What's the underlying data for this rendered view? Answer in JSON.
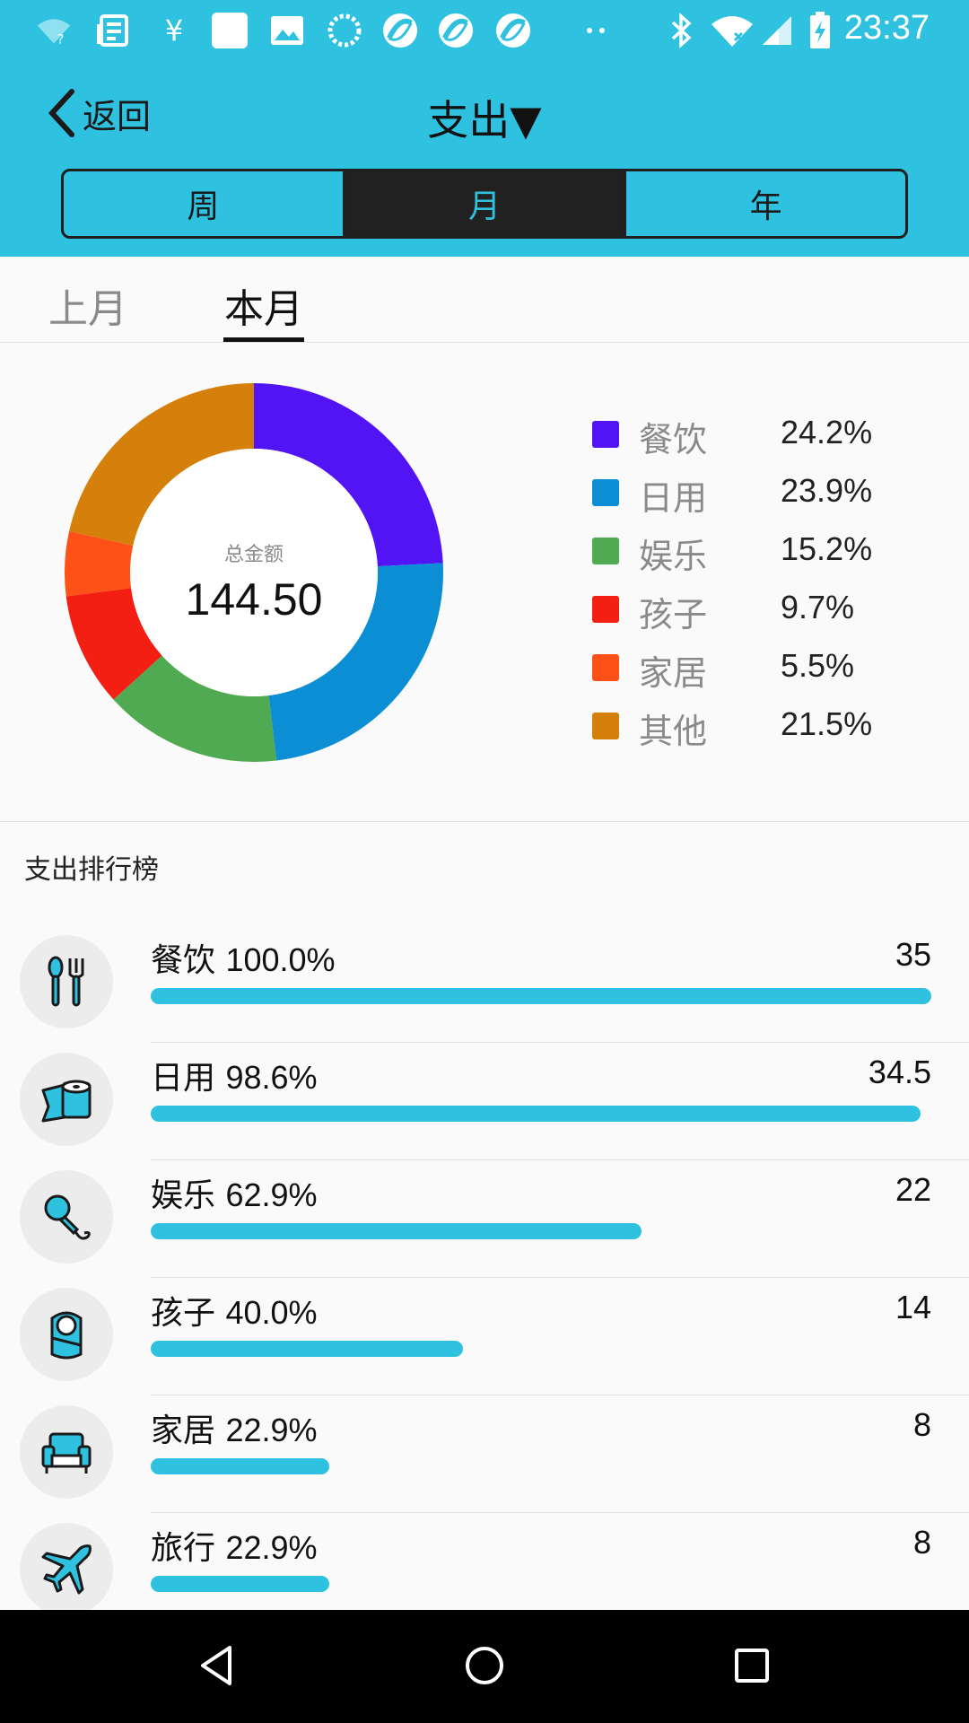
{
  "status_bar": {
    "time": "23:37",
    "icons": [
      "wifi-question-icon",
      "news-icon",
      "yen-icon",
      "square-app-icon",
      "gallery-icon",
      "loading-icon",
      "app-icon",
      "app-icon",
      "app-icon",
      "more-dots-icon",
      "bluetooth-icon",
      "wifi-icon",
      "signal-icon",
      "battery-charging-icon"
    ]
  },
  "header": {
    "back_label": "返回",
    "title": "支出▼",
    "segments": [
      {
        "label": "周",
        "active": false
      },
      {
        "label": "月",
        "active": true
      },
      {
        "label": "年",
        "active": false
      }
    ]
  },
  "month_tabs": [
    {
      "label": "上月",
      "active": false
    },
    {
      "label": "本月",
      "active": true
    }
  ],
  "chart_data": {
    "type": "pie",
    "center_label": "总金额",
    "center_value": "144.50",
    "slices": [
      {
        "name": "餐饮",
        "percent_label": "24.2%",
        "value": 24.2,
        "color": "#5214f5"
      },
      {
        "name": "日用",
        "percent_label": "23.9%",
        "value": 23.9,
        "color": "#0b8ed4"
      },
      {
        "name": "娱乐",
        "percent_label": "15.2%",
        "value": 15.2,
        "color": "#4faa52"
      },
      {
        "name": "孩子",
        "percent_label": "9.7%",
        "value": 9.7,
        "color": "#f41f13"
      },
      {
        "name": "家居",
        "percent_label": "5.5%",
        "value": 5.5,
        "color": "#fe5117"
      },
      {
        "name": "其他",
        "percent_label": "21.5%",
        "value": 21.5,
        "color": "#d4800a"
      }
    ],
    "legend_position": "right"
  },
  "ranking": {
    "title": "支出排行榜",
    "items": [
      {
        "name": "餐饮",
        "percent": "100.0%",
        "amount": "35",
        "fraction": 1.0,
        "icon": "utensils-icon"
      },
      {
        "name": "日用",
        "percent": "98.6%",
        "amount": "34.5",
        "fraction": 0.986,
        "icon": "toilet-paper-icon"
      },
      {
        "name": "娱乐",
        "percent": "62.9%",
        "amount": "22",
        "fraction": 0.629,
        "icon": "microphone-icon"
      },
      {
        "name": "孩子",
        "percent": "40.0%",
        "amount": "14",
        "fraction": 0.4,
        "icon": "baby-icon"
      },
      {
        "name": "家居",
        "percent": "22.9%",
        "amount": "8",
        "fraction": 0.229,
        "icon": "armchair-icon"
      },
      {
        "name": "旅行",
        "percent": "22.9%",
        "amount": "8",
        "fraction": 0.229,
        "icon": "airplane-icon"
      }
    ]
  },
  "colors": {
    "accent": "#2fc2e0",
    "segment_active_bg": "#212121"
  },
  "navbar": {
    "buttons": [
      "back-triangle-icon",
      "home-circle-icon",
      "recents-square-icon"
    ]
  }
}
